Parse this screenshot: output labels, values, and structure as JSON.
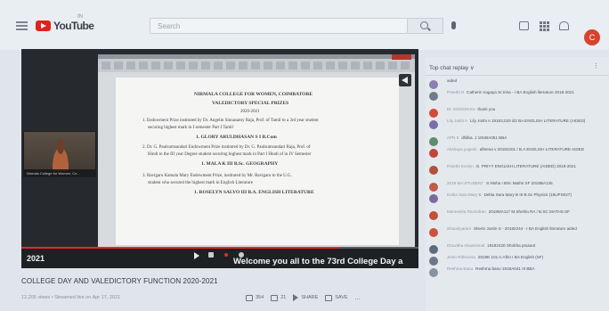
{
  "masthead": {
    "logo_text": "YouTube",
    "country_code": "IN",
    "search_placeholder": "Search",
    "avatar_letter": "C"
  },
  "player": {
    "year_label": "2021",
    "caption": "Welcome you all to the 73rd College Day a",
    "progress_fraction": 0.8,
    "webcam_label": "Nirmala College for Women, Co...",
    "document": {
      "lines": [
        {
          "text": "NIRMALA COLLEGE FOR WOMEN, COIMBATORE",
          "head": true
        },
        {
          "text": "VALEDICTORY  SPECIAL PRIZES",
          "head": true
        },
        {
          "text": "2020-2021",
          "head": false
        },
        {
          "text": "1. Endowment Prize instituted by Dr. Angelin Sinnasamy Raja, Prof. of Tamil to a 3rd year student",
          "head": false
        },
        {
          "text": "securing highest mark in I semester Part I Tamil",
          "head": false
        },
        {
          "text": "1. GLORY ARULDHASAN S   I B.Com",
          "head": true
        },
        {
          "text": "2. Dr. G. Paulsumsundari Endowment Prize instituted by Dr. G. Paulsumsundari Raja, Prof. of",
          "head": false
        },
        {
          "text": "Hindi to the III year Degree student securing highest mark in Part I Hindi of in IV Semester",
          "head": false
        },
        {
          "text": "1. MALA K      III B.Sc. GEOGRAPHY",
          "head": true
        },
        {
          "text": "3. Ravigaru Kamala Mary Endowment Prize, instituted by Mr. Ravigaru to the U.G.",
          "head": false
        },
        {
          "text": "student who secured the highest mark in English Literature",
          "head": false
        },
        {
          "text": "1. ROSELYN SALVO     III B.A. ENGLISH LITERATURE",
          "head": true
        }
      ]
    }
  },
  "video": {
    "title": "COLLEGE DAY AND VALEDICTORY FUNCTION 2020-2021",
    "meta": "12,205 views • Streamed live on Apr 17, 2021",
    "like_count": "354",
    "comment_count": "21",
    "share_label": "SHARE",
    "save_label": "SAVE",
    "more_label": "..."
  },
  "chat": {
    "header": "Top chat replay ∨",
    "more_label": "⋮",
    "messages": [
      {
        "author": "",
        "text": "aided",
        "avatar_color": "#8a7fb0"
      },
      {
        "author": "Preethi R",
        "text": "Catherin nagaya Sr.Irina - I BA English literature 2018-2021",
        "avatar_color": "#6f7d8a"
      },
      {
        "author": "Dr. EDISON Ks",
        "text": "thank you",
        "avatar_color": "#d64a36"
      },
      {
        "author": "Lily Joshi A",
        "text": "Lily Joshi A 19163,020 ii/2 BA ENGLISH LITERATURE (AIDED)",
        "avatar_color": "#7a6fa6"
      },
      {
        "author": "APR 5",
        "text": "dhilba. J 18UBA051 BBA",
        "avatar_color": "#5d8c6e"
      },
      {
        "author": "Akshaya yogesh",
        "text": "afleena v 20182201 / B.A ENGLISH LITERATURE AIDED",
        "avatar_color": "#c0463a"
      },
      {
        "author": "Preethi Evelyn",
        "text": "G. PRIYY ENGLISH LITERATURE (AIDED) 2018-2021",
        "avatar_color": "#b0503e"
      },
      {
        "author": "2019 MA STUDENT",
        "text": "S.Nisha I BSc Maths SF 2018BA135",
        "avatar_color": "#c25b48"
      },
      {
        "author": "Deltia Sara Mary B",
        "text": "Deltia Sara Mary B III B.Sc Physics (18UPS027)",
        "avatar_color": "#7d6a9c"
      },
      {
        "author": "Maneesha Ravindran",
        "text": "2018MA117 M.Shehla RA / B.SC MATHS SF",
        "avatar_color": "#c4503c"
      },
      {
        "author": "ishwariyarani",
        "text": "Sherin Justin S - 20182244 - I BA English literature aided",
        "avatar_color": "#cc5240"
      },
      {
        "author": "Dhuvitha shawstimal",
        "text": "19182420 Shobha prasant",
        "avatar_color": "#5e6d7c"
      },
      {
        "author": "Jenin Rithoorsa",
        "text": "2019E 101 A.Afrin I BA English (SF)",
        "avatar_color": "#6a788a"
      },
      {
        "author": "Reshma Banu",
        "text": "Reshma banu 1918A041 III BBA",
        "avatar_color": "#8893a0"
      }
    ]
  }
}
